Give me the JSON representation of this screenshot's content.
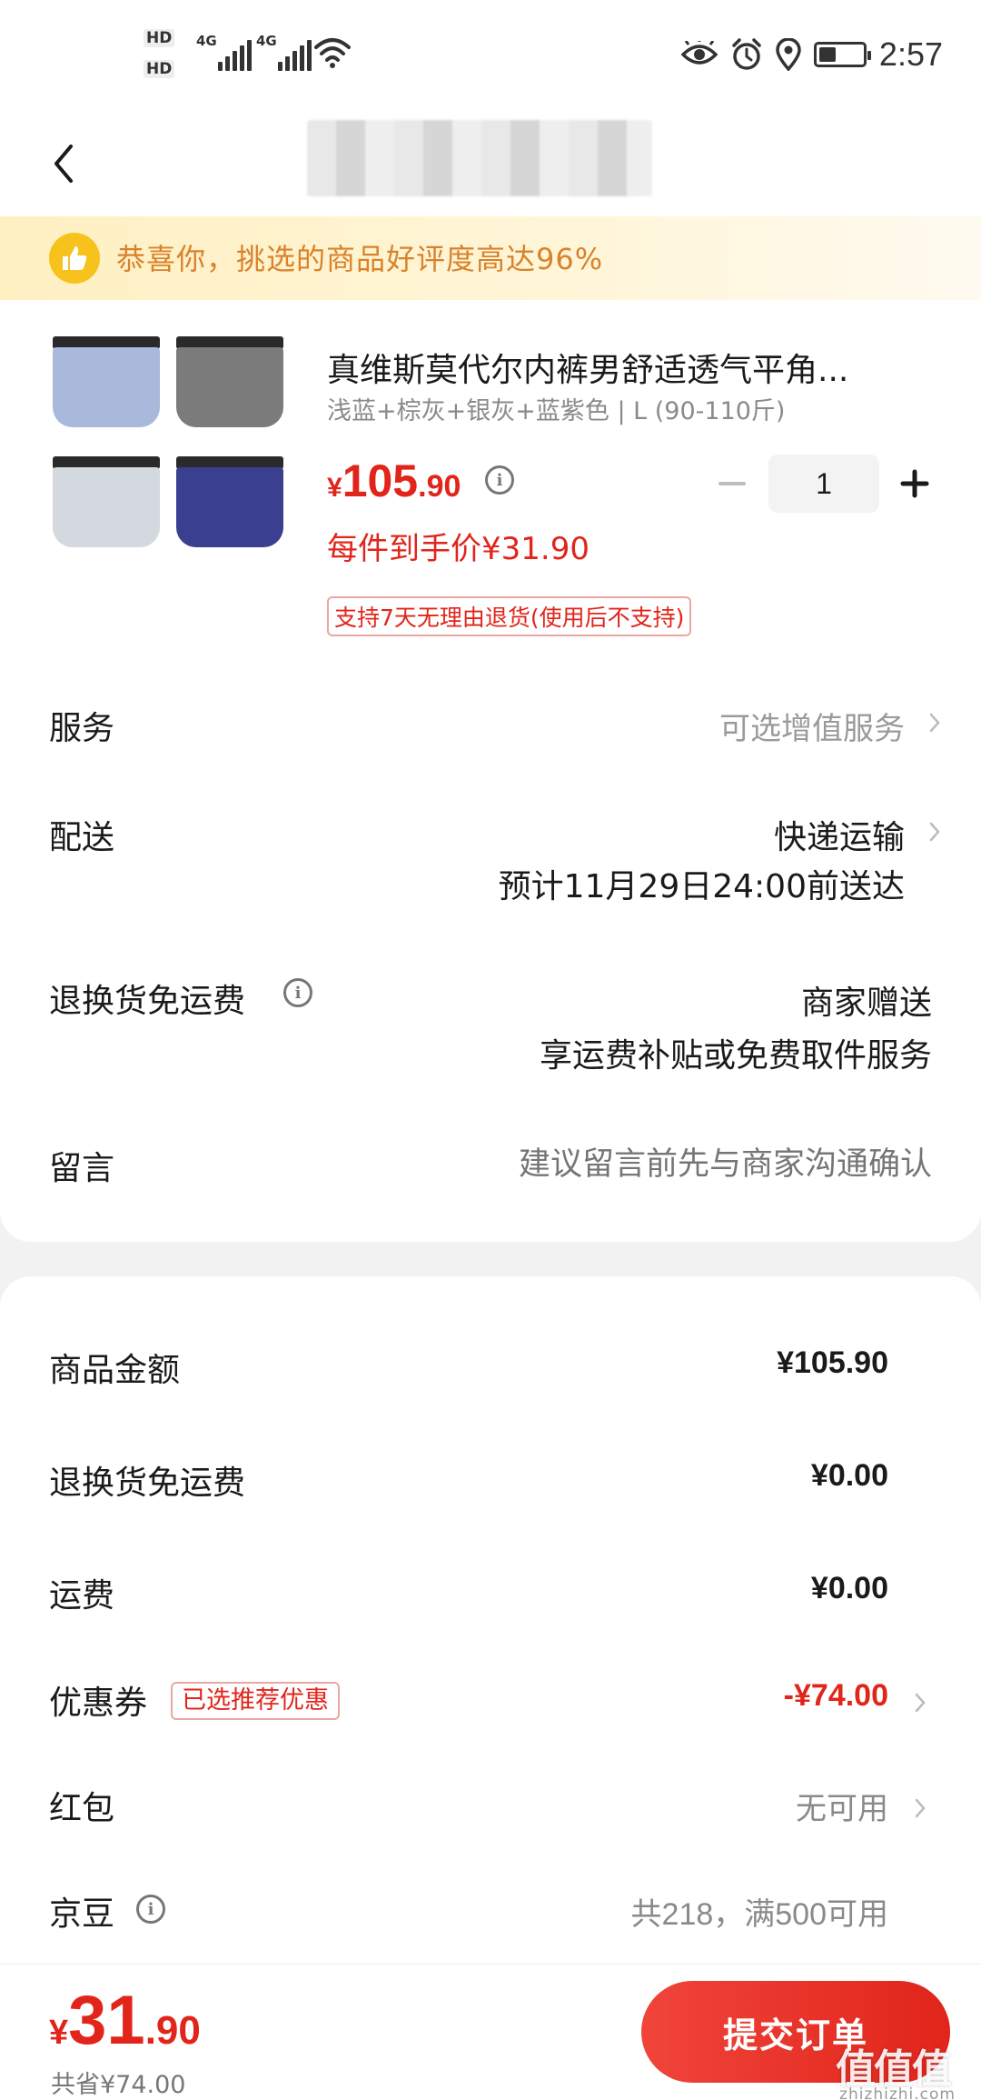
{
  "status_bar": {
    "hd1": "HD",
    "hd2": "HD",
    "net1": "4G",
    "net2": "4G",
    "time": "2:57",
    "icons": [
      "eye-icon",
      "alarm-icon",
      "location-icon",
      "battery-icon"
    ],
    "battery_level": 0.35
  },
  "nav": {
    "title_obscured": true
  },
  "banner": {
    "text": "恭喜你，挑选的商品好评度高达96%"
  },
  "product": {
    "title": "真维斯莫代尔内裤男舒适透气平角...",
    "spec": "浅蓝+棕灰+银灰+蓝紫色 | L (90-110斤)",
    "price_currency": "¥",
    "price_int": "105",
    "price_dec": ".90",
    "quantity": "1",
    "per_item_price": "每件到手价¥31.90",
    "return_policy": "支持7天无理由退货(使用后不支持)",
    "colors": [
      "#a9b9dc",
      "#7b7b7b",
      "#d4d8df",
      "#3a3f8f"
    ]
  },
  "options": {
    "service_label": "服务",
    "service_value": "可选增值服务",
    "delivery_label": "配送",
    "delivery_method": "快递运输",
    "delivery_eta": "预计11月29日24:00前送达",
    "return_shipping_label": "退换货免运费",
    "return_shipping_value": "商家赠送",
    "return_shipping_desc": "享运费补贴或免费取件服务",
    "message_label": "留言",
    "message_placeholder": "建议留言前先与商家沟通确认"
  },
  "summary": {
    "goods_amount_label": "商品金额",
    "goods_amount_value": "¥105.90",
    "return_shipping_label": "退换货免运费",
    "return_shipping_value": "¥0.00",
    "shipping_label": "运费",
    "shipping_value": "¥0.00",
    "coupon_label": "优惠券",
    "coupon_tag": "已选推荐优惠",
    "coupon_value": "-¥74.00",
    "red_packet_label": "红包",
    "red_packet_value": "无可用",
    "jingdou_label": "京豆",
    "jingdou_value": "共218，满500可用"
  },
  "bottom": {
    "total_currency": "¥",
    "total_int": "31",
    "total_dec": ".90",
    "saved": "共省¥74.00",
    "submit_label": "提交订单"
  },
  "watermark": {
    "logo": "值值值",
    "url": "zhizhizhi.com"
  },
  "colors": {
    "accent": "#e1251b",
    "banner_text": "#d9822b",
    "muted": "#8a8a8a"
  }
}
